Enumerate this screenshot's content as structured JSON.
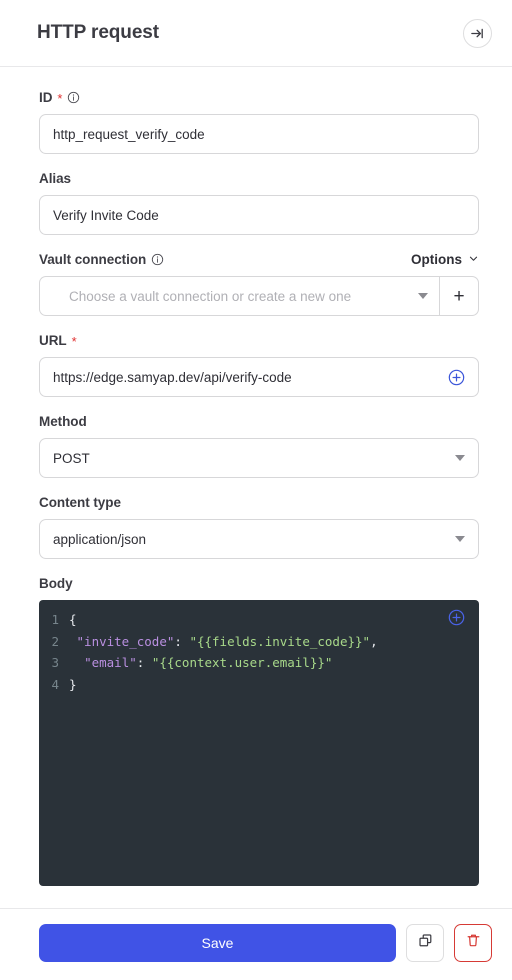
{
  "header": {
    "title": "HTTP request",
    "collapse_icon": "collapse-panel-right-icon"
  },
  "form": {
    "id_field": {
      "label": "ID",
      "required_marker": "*",
      "info_icon": "info-icon",
      "value": "http_request_verify_code"
    },
    "alias_field": {
      "label": "Alias",
      "value": "Verify Invite Code"
    },
    "vault_field": {
      "label": "Vault connection",
      "info_icon": "info-icon",
      "options_label": "Options",
      "chevron_icon": "chevron-down-icon",
      "placeholder": "Choose a vault connection or create a new one",
      "add_label": "+"
    },
    "url_field": {
      "label": "URL",
      "required_marker": "*",
      "value": "https://edge.samyap.dev/api/verify-code",
      "add_icon": "plus-circle-icon"
    },
    "method_field": {
      "label": "Method",
      "value": "POST"
    },
    "content_type_field": {
      "label": "Content type",
      "value": "application/json"
    },
    "body_field": {
      "label": "Body",
      "add_icon": "plus-circle-icon",
      "lines": [
        {
          "num": "1",
          "tokens": [
            {
              "t": "punc",
              "v": "{"
            }
          ]
        },
        {
          "num": "2",
          "tokens": [
            {
              "t": "punc",
              "v": " "
            },
            {
              "t": "key",
              "v": "\"invite_code\""
            },
            {
              "t": "punc",
              "v": ": "
            },
            {
              "t": "str",
              "v": "\"{{fields.invite_code}}\""
            },
            {
              "t": "punc",
              "v": ","
            }
          ]
        },
        {
          "num": "3",
          "tokens": [
            {
              "t": "punc",
              "v": "  "
            },
            {
              "t": "key",
              "v": "\"email\""
            },
            {
              "t": "punc",
              "v": ": "
            },
            {
              "t": "str",
              "v": "\"{{context.user.email}}\""
            }
          ]
        },
        {
          "num": "4",
          "tokens": [
            {
              "t": "punc",
              "v": "}"
            }
          ]
        }
      ]
    }
  },
  "footer": {
    "save_label": "Save",
    "duplicate_icon": "duplicate-icon",
    "delete_icon": "trash-icon"
  },
  "colors": {
    "accent": "#4053e6",
    "danger": "#d63a35",
    "required": "#e03030",
    "editor_bg": "#2a3239",
    "code_key": "#b98fe0",
    "code_string": "#a8d98a",
    "code_punc": "#e6e9ed",
    "line_number": "#77858c"
  }
}
